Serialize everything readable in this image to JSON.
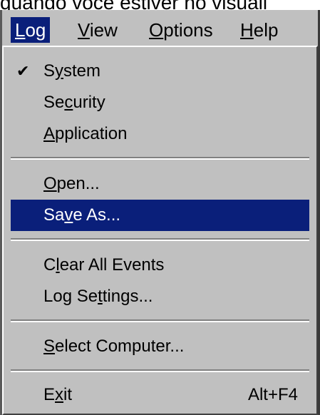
{
  "background_text": "quando voce estiver no visuali",
  "menubar": {
    "items": [
      {
        "label": "Log",
        "mnemonic": "L",
        "rest": "og",
        "active": true
      },
      {
        "label": "View",
        "mnemonic": "V",
        "rest": "iew"
      },
      {
        "label": "Options",
        "mnemonic": "O",
        "rest": "ptions"
      },
      {
        "label": "Help",
        "mnemonic": "H",
        "rest": "elp"
      }
    ]
  },
  "menu": {
    "items": [
      {
        "label": "System",
        "pre": "S",
        "mn": "y",
        "post": "stem",
        "checked": true
      },
      {
        "label": "Security",
        "pre": "Se",
        "mn": "c",
        "post": "urity"
      },
      {
        "label": "Application",
        "pre": "",
        "mn": "A",
        "post": "pplication"
      },
      {
        "label": "Open...",
        "pre": "",
        "mn": "O",
        "post": "pen..."
      },
      {
        "label": "Save As...",
        "pre": "Sa",
        "mn": "v",
        "post": "e As...",
        "highlighted": true
      },
      {
        "label": "Clear All Events",
        "pre": "C",
        "mn": "l",
        "post": "ear All Events"
      },
      {
        "label": "Log Settings...",
        "pre": "Log Se",
        "mn": "t",
        "post": "tings..."
      },
      {
        "label": "Select Computer...",
        "pre": "",
        "mn": "S",
        "post": "elect Computer..."
      },
      {
        "label": "Exit",
        "pre": "E",
        "mn": "x",
        "post": "it",
        "shortcut": "Alt+F4"
      }
    ],
    "check_glyph": "✔"
  },
  "colors": {
    "menu_bg": "#c0c0c0",
    "highlight_bg": "#0a1f7a",
    "highlight_text": "#ffffff"
  }
}
